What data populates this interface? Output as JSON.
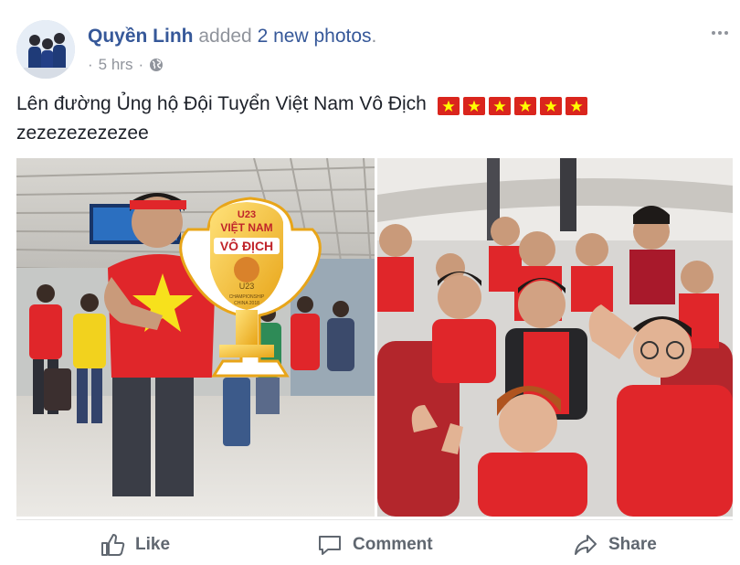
{
  "post": {
    "author": "Quyền Linh",
    "action_text": "added",
    "photos_link": "2 new photos",
    "punct": ".",
    "time_prefix": "·",
    "time": "5 hrs",
    "time_suffix": "·",
    "audience_icon": "globe-icon",
    "message_line1": "Lên đường Ủng hộ Đội Tuyển Việt Nam Vô Địch",
    "flag_count": 6,
    "flag_emoji": "vietnam-flag",
    "message_line2": "zezezezezezee",
    "more_icon": "more-options-icon"
  },
  "photos": [
    {
      "name": "airport-photo",
      "sign_line1": "U23",
      "sign_line2": "VIỆT NAM",
      "sign_line3": "VÔ ĐỊCH",
      "sign_small1": "U23",
      "sign_small2": "CHAMPIONSHIP",
      "sign_small3": "CHINA 2018"
    },
    {
      "name": "airplane-group-photo"
    }
  ],
  "actions": {
    "like_label": "Like",
    "comment_label": "Comment",
    "share_label": "Share"
  },
  "colors": {
    "link_blue": "#365899",
    "meta_gray": "#90949c",
    "flag_red": "#da251d",
    "flag_star": "#ffff00",
    "action_gray": "#606770"
  }
}
